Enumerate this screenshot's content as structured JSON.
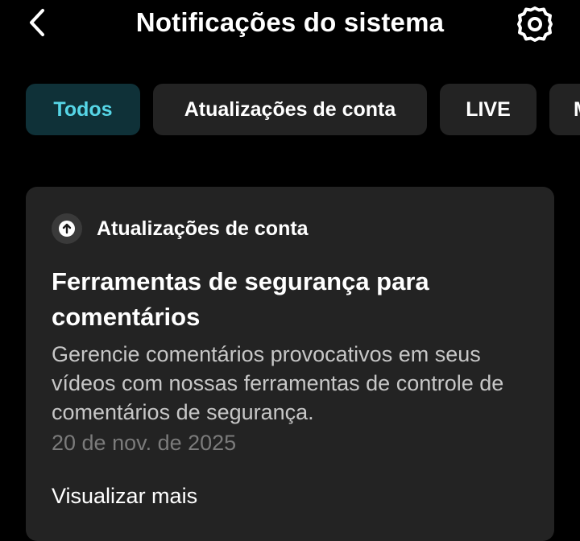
{
  "header": {
    "title": "Notificações do sistema",
    "back_icon": "chevron-left-icon",
    "settings_icon": "gear-icon"
  },
  "tabs": [
    {
      "label": "Todos",
      "active": true
    },
    {
      "label": "Atualizações de conta",
      "active": false
    },
    {
      "label": "LIVE",
      "active": false
    },
    {
      "label": "M",
      "active": false
    }
  ],
  "notification": {
    "category": "Atualizações de conta",
    "category_icon": "arrow-up-circle-icon",
    "title": "Ferramentas de segurança para comentários",
    "description": "Gerencie comentários provocativos em seus vídeos com nossas ferramentas de controle de comentários de segurança.",
    "date": "20 de nov. de 2025",
    "view_more": "Visualizar mais"
  },
  "colors": {
    "background": "#000000",
    "card": "#232323",
    "active_tab_bg": "#0f3138",
    "active_tab_text": "#56d5e6",
    "secondary_text": "#c7c7c7",
    "date_text": "#7b7b7b"
  }
}
